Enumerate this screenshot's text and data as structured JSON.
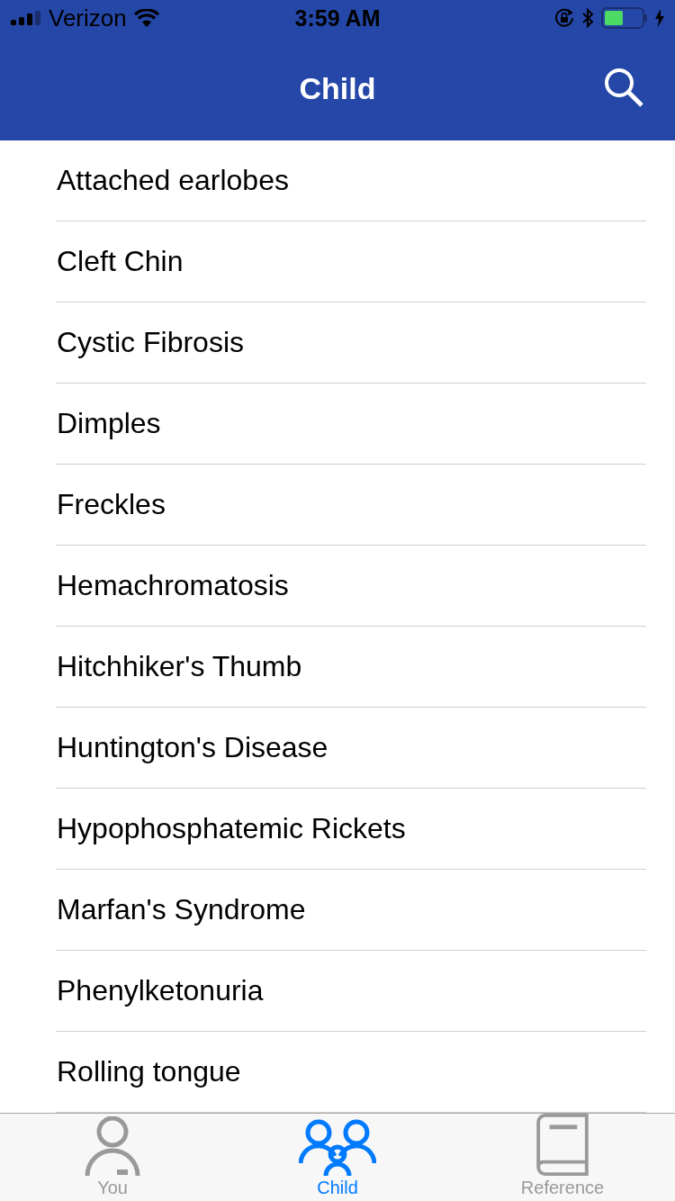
{
  "status_bar": {
    "carrier": "Verizon",
    "time": "3:59 AM"
  },
  "nav_bar": {
    "title": "Child"
  },
  "list": [
    {
      "label": "Attached earlobes"
    },
    {
      "label": "Cleft Chin"
    },
    {
      "label": "Cystic Fibrosis"
    },
    {
      "label": "Dimples"
    },
    {
      "label": "Freckles"
    },
    {
      "label": "Hemachromatosis"
    },
    {
      "label": "Hitchhiker's Thumb"
    },
    {
      "label": "Huntington's Disease"
    },
    {
      "label": "Hypophosphatemic Rickets"
    },
    {
      "label": "Marfan's Syndrome"
    },
    {
      "label": "Phenylketonuria"
    },
    {
      "label": "Rolling tongue"
    }
  ],
  "tab_bar": [
    {
      "label": "You",
      "kind": "person",
      "selected": false
    },
    {
      "label": "Child",
      "kind": "family",
      "selected": true
    },
    {
      "label": "Reference",
      "kind": "book",
      "selected": false
    }
  ]
}
